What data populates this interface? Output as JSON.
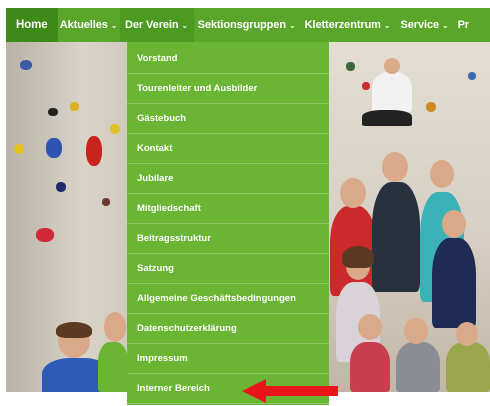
{
  "nav": {
    "items": [
      {
        "label": "Home",
        "caret": ""
      },
      {
        "label": "Aktuelles",
        "caret": "⌄"
      },
      {
        "label": "Der Verein",
        "caret": "⌄"
      },
      {
        "label": "Sektionsgruppen",
        "caret": "⌄"
      },
      {
        "label": "Kletterzentrum",
        "caret": "⌄"
      },
      {
        "label": "Service",
        "caret": "⌄"
      },
      {
        "label": "Pr",
        "caret": ""
      }
    ]
  },
  "dropdown": {
    "items": [
      "Vorstand",
      "Tourenleiter und Ausbilder",
      "Gästebuch",
      "Kontakt",
      "Jubilare",
      "Mitgliedschaft",
      "Beitragsstruktur",
      "Satzung",
      "Allgemeine Geschäftsbedingungen",
      "Datenschutzerklärung",
      "Impressum",
      "Interner Bereich"
    ]
  },
  "colors": {
    "nav_bg": "#5aa62a",
    "nav_home": "#3e8a18",
    "dropdown_bg": "#6ab534",
    "arrow": "#e8161b"
  }
}
